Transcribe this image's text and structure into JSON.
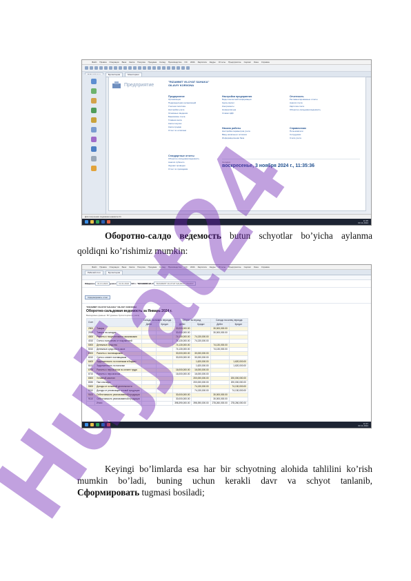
{
  "screenshot1": {
    "window_title": "1С:Предприятие - Бухгалтерия предприятия, редакция 3.0",
    "menu": [
      "Файл",
      "Правка",
      "Операции",
      "Банк",
      "Касса",
      "Покупка",
      "Продажа",
      "Склад",
      "Производство",
      "ОС",
      "НМА",
      "Зарплата",
      "Кадры",
      "Отчеты",
      "Предприятие",
      "Сервис",
      "Окна",
      "Справка"
    ],
    "tabs": [
      "Рабочий стол",
      "Бухгалтерия",
      "Мониторинг"
    ],
    "section_label": "Предприятие",
    "org_name_1": "\"RIZAMMIT VILOYAT SAHAKA\"",
    "org_name_2": "OILAVIY KORXONA",
    "groups": [
      {
        "title": "Предприятие",
        "links": [
          "Организации",
          "Подразделения организаций",
          "Учетная политика",
          "Настройка учета",
          "Основные сведения",
          "Банковские счета",
          "Главная книга",
          "Книга покупок",
          "Книга продаж",
          "Отчет по остаткам"
        ]
      },
      {
        "title": "Настройки предприятия",
        "links": [
          "Виды контактной информации",
          "Курсы валют",
          "Контрагенты",
          "Номенклатура",
          "Ставки НДС"
        ]
      },
      {
        "title": "Отчетность",
        "links": [
          "Регламентированные отчеты",
          "Анализ счета",
          "Карточка счета",
          "Оборотно-сальдовая ведомость"
        ]
      },
      {
        "title": "Начало работы",
        "links": [
          "Настройка параметров учета",
          "Ввод начальных остатков",
          "Информационная база"
        ]
      },
      {
        "title": "Справочники",
        "links": [
          "Пользователи",
          "Сотрудники",
          "Счета учета"
        ]
      },
      {
        "title": "Стандартные отчеты",
        "links": [
          "Оборотно-сальдовая ведомость",
          "Анализ субконто",
          "Журнал проводок",
          "Отчет по проводкам"
        ]
      }
    ],
    "today_label": "Сегодня:",
    "today_value": "воскресенье, 3 ноября 2024 г., 11:35:36",
    "status_text": "Для получения подсказки нажмите F1",
    "clock_time": "11:35",
    "clock_date": "03.11.2024"
  },
  "paragraph1": {
    "bold": "Оборотно-салдо ведемость",
    "rest": " butun schyotlar bo’yicha aylanma qoldiqni ko’rishimiz mumkin:"
  },
  "screenshot2": {
    "window_title": "Оборотно-сальдовая ведомость за Январь 2024 г. \"RIZAMMIT VILOYAT SAHAKA\" OILAVIY KORXONA",
    "tabs": [
      "Рабочий стол",
      "Бухгалтерия"
    ],
    "period_label": "Период:",
    "period_from": "01.01.2024",
    "period_to": "31.01.2024",
    "org_label": "Организация:",
    "org_value": "\"RIZAMMIT VILOYAT SAHAKA\" OILAVIY",
    "form_button": "Сформировать отчет",
    "report_org": "\"RIZAMMIT VILOYAT SAHAKA\" OILAVIY KORXONA",
    "report_title": "Оборотно-сальдовая ведомость за Январь 2024 г.",
    "report_subtitle": "Выводимые данные: БУ (данные бухгалтерского учета)",
    "headers": [
      "Счет",
      "Сальдо на начало периода",
      "Оборот за период",
      "Сальдо на конец периода"
    ],
    "subheaders": [
      "Дебет",
      "Кредит",
      "Дебет",
      "Кредит",
      "Дебет",
      "Кредит"
    ],
    "rows": [
      [
        "2900",
        "Товары",
        "",
        "",
        "30,000,000.00",
        "",
        "30,000,000.00",
        ""
      ],
      [
        "2910",
        "Товары на складах",
        "",
        "",
        "30,000,000.00",
        "",
        "30,000,000.00",
        ""
      ],
      [
        "4000",
        "Расчеты с покупателями и заказчиками",
        "",
        "",
        "74,130,000.00",
        "74,130,000.00",
        "",
        ""
      ],
      [
        "4010",
        "Счета к получению от покупателей",
        "",
        "",
        "74,130,000.00",
        "74,130,000.00",
        "",
        ""
      ],
      [
        "5000",
        "Денежные средства",
        "",
        "",
        "74,130,000.00",
        "",
        "74,130,000.00",
        ""
      ],
      [
        "5010",
        "Денежные средства в кассе",
        "",
        "",
        "74,130,000.00",
        "",
        "74,130,000.00",
        ""
      ],
      [
        "6000",
        "Расчеты с поставщиками",
        "",
        "",
        "30,000,000.00",
        "30,000,000.00",
        "",
        ""
      ],
      [
        "6010",
        "Счета к оплате поставщикам",
        "",
        "",
        "30,000,000.00",
        "30,000,000.00",
        "",
        ""
      ],
      [
        "6400",
        "Задолженность по платежам в бюджет",
        "",
        "",
        "",
        "1,620,000.00",
        "",
        "1,620,000.00"
      ],
      [
        "6410",
        "Задолженность по налогам",
        "",
        "",
        "",
        "1,620,000.00",
        "",
        "1,620,000.00"
      ],
      [
        "6700",
        "Расчеты с персоналом по оплате труда",
        "",
        "",
        "16,000,000.00",
        "16,000,000.00",
        "",
        ""
      ],
      [
        "6710",
        "Расчеты с персоналом",
        "",
        "",
        "16,000,000.00",
        "16,000,000.00",
        "",
        ""
      ],
      [
        "8300",
        "Уставный капитал",
        "",
        "",
        "",
        "200,000,000.00",
        "",
        "200,000,000.00"
      ],
      [
        "8330",
        "Паи и вклады",
        "",
        "",
        "",
        "200,000,000.00",
        "",
        "200,000,000.00"
      ],
      [
        "9000",
        "Доходы от основной деятельности",
        "",
        "",
        "",
        "74,130,000.00",
        "",
        "74,130,000.00"
      ],
      [
        "9010",
        "Доходы от реализации готовой продукции",
        "",
        "",
        "",
        "74,130,000.00",
        "",
        "74,130,000.00"
      ],
      [
        "9100",
        "Себестоимость реализованной продукции",
        "",
        "",
        "30,000,000.00",
        "",
        "30,000,000.00",
        ""
      ],
      [
        "9110",
        "Себестоимость реализованной продукции",
        "",
        "",
        "30,000,000.00",
        "",
        "30,000,000.00",
        ""
      ],
      [
        "",
        "Итого",
        "",
        "",
        "398,390,000.00",
        "398,390,000.00",
        "278,260,000.00",
        "278,260,000.00"
      ]
    ],
    "clock_time": "11:37",
    "clock_date": "03.11.2024"
  },
  "paragraph2": {
    "text_1": "Keyingi bo’limlarda esa har bir schyotning alohida tahlilini ko’rish mumkin bo’ladi, buning uchun kerakli davr va schyot tanlanib, ",
    "bold": "Сформировать",
    "text_2": " tugmasi bosiladi;"
  },
  "watermark": {
    "text": "Hujjat24",
    "color": "#6b1fb3"
  }
}
